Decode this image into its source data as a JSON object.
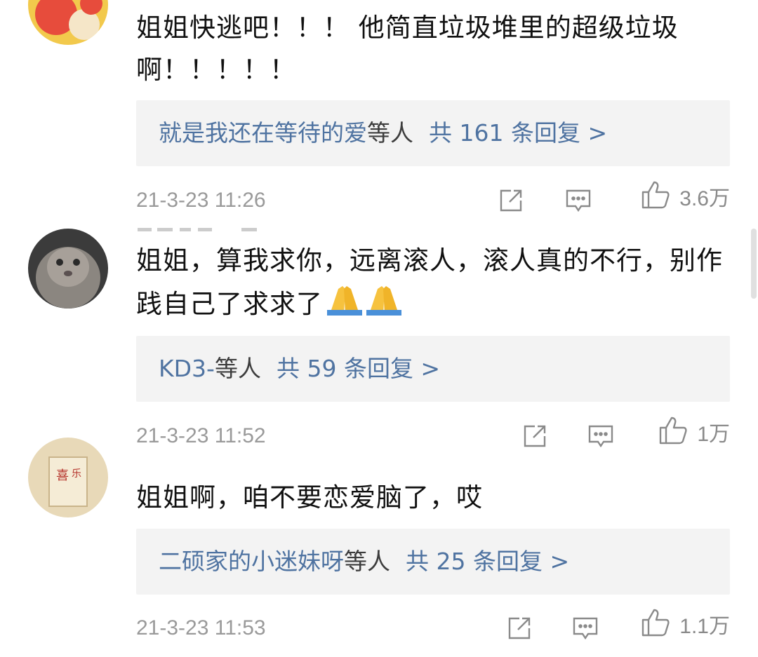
{
  "comments": [
    {
      "text": "姐姐快逃吧！！！ 他简直垃圾堆里的超级垃圾啊！！！！！",
      "reply_names": "就是我还在等待的爱",
      "reply_suffix": "等人",
      "reply_count": "共 161 条回复 >",
      "timestamp": "21-3-23 11:26",
      "likes": "3.6万"
    },
    {
      "text": "姐姐，算我求你，远离滚人，滚人真的不行，别作践自己了求求了",
      "emoji": "🙏🙏",
      "reply_names": "KD3-",
      "reply_suffix": "等人",
      "reply_count": "共 59 条回复 >",
      "timestamp": "21-3-23 11:52",
      "likes": "1万"
    },
    {
      "text": "姐姐啊，咱不要恋爱脑了，哎",
      "reply_names": "二硕家的小迷妹呀",
      "reply_suffix": "等人",
      "reply_count": "共 25 条回复 >",
      "timestamp": "21-3-23 11:53",
      "likes": "1.1万"
    }
  ],
  "icons": {
    "share": "share-icon",
    "comment": "comment-icon",
    "like": "thumbs-up-icon"
  },
  "colors": {
    "link": "#4f73a1",
    "reply_bg": "#f3f3f3",
    "meta": "#9a9a9a"
  }
}
